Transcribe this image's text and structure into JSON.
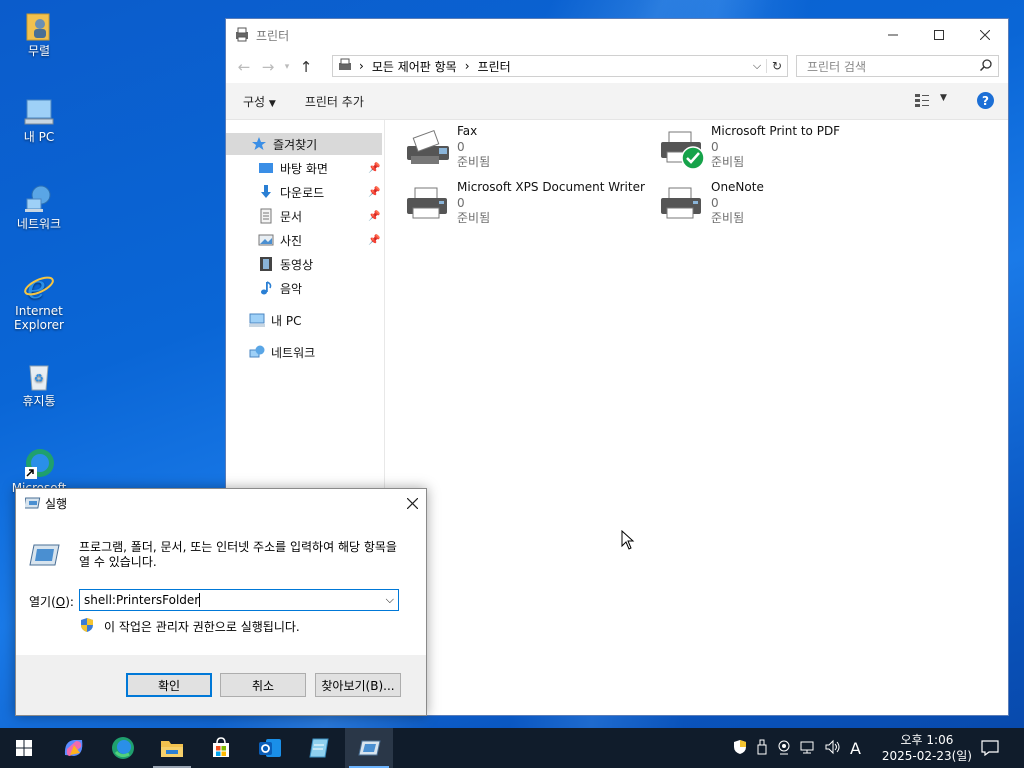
{
  "desktop": {
    "icons": [
      {
        "label": "무렬"
      },
      {
        "label": "내 PC"
      },
      {
        "label": "네트워크"
      },
      {
        "label": "Internet Explorer"
      },
      {
        "label": "휴지통"
      },
      {
        "label": "Microsoft"
      }
    ]
  },
  "explorer": {
    "title": "프린터",
    "address": {
      "crumb1": "모든 제어판 항목",
      "crumb2": "프린터",
      "sep": "›"
    },
    "search_placeholder": "프린터 검색",
    "commands": {
      "organize": "구성",
      "add_printer": "프린터 추가"
    },
    "nav": {
      "favorites": "즐겨찾기",
      "desktop": "바탕 화면",
      "downloads": "다운로드",
      "documents": "문서",
      "pictures": "사진",
      "videos": "동영상",
      "music": "음악",
      "this_pc": "내 PC",
      "network": "네트워크"
    },
    "printers": [
      {
        "name": "Fax",
        "count": "0",
        "status": "준비됨"
      },
      {
        "name": "Microsoft Print to PDF",
        "count": "0",
        "status": "준비됨",
        "default": true
      },
      {
        "name": "Microsoft XPS Document Writer",
        "count": "0",
        "status": "준비됨"
      },
      {
        "name": "OneNote",
        "count": "0",
        "status": "준비됨"
      }
    ]
  },
  "run_dialog": {
    "title": "실행",
    "description": "프로그램, 폴더, 문서, 또는 인터넷 주소를 입력하여 해당 항목을 열 수 있습니다.",
    "open_label_pre": "열기(",
    "open_label_key": "O",
    "open_label_post": "):",
    "input_value": "shell:PrintersFolder",
    "admin_note": "이 작업은 관리자 권한으로 실행됩니다.",
    "ok": "확인",
    "cancel": "취소",
    "browse": "찾아보기(B)..."
  },
  "taskbar": {
    "ime": "A",
    "time": "오후 1:06",
    "date": "2025-02-23(일)"
  },
  "colors": {
    "accent": "#0078d7",
    "taskbar": "#101c2b",
    "desktop": "#0a66d6"
  }
}
